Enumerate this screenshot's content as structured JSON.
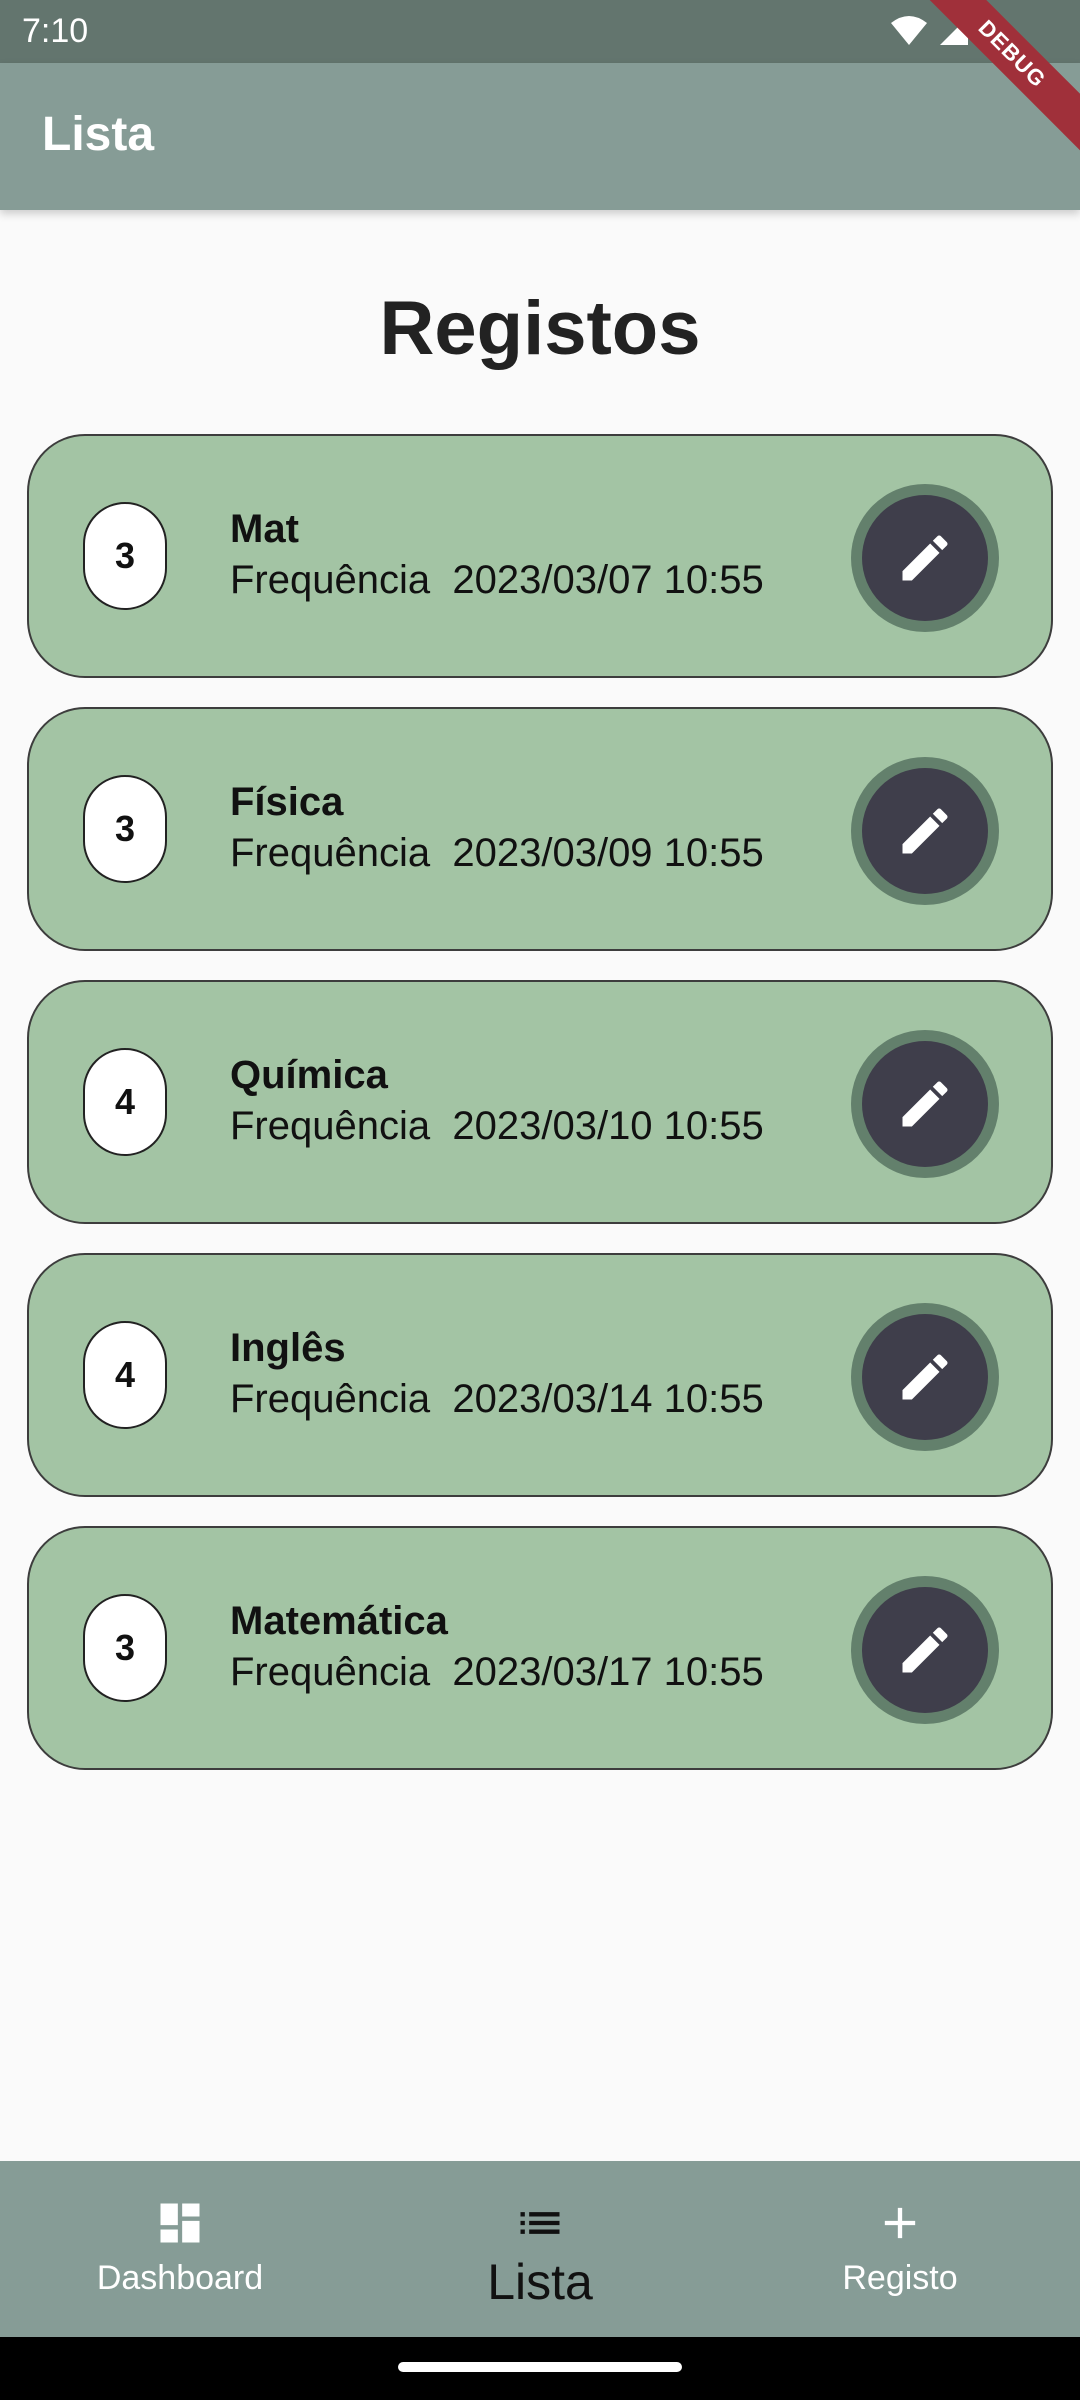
{
  "status_bar": {
    "time": "7:10",
    "icons": [
      "wifi-icon",
      "signal-icon",
      "battery-icon"
    ]
  },
  "debug_banner": "DEBUG",
  "app_bar": {
    "title": "Lista"
  },
  "page": {
    "heading": "Registos"
  },
  "frequency_label": "Frequência",
  "records": [
    {
      "count": "3",
      "subject": "Mat",
      "datetime": "2023/03/07 10:55"
    },
    {
      "count": "3",
      "subject": "Física",
      "datetime": "2023/03/09 10:55"
    },
    {
      "count": "4",
      "subject": "Química",
      "datetime": "2023/03/10 10:55"
    },
    {
      "count": "4",
      "subject": "Inglês",
      "datetime": "2023/03/14 10:55"
    },
    {
      "count": "3",
      "subject": "Matemática",
      "datetime": "2023/03/17 10:55"
    }
  ],
  "bottom_nav": {
    "items": [
      {
        "label": "Dashboard",
        "icon": "dashboard-icon",
        "active": false
      },
      {
        "label": "Lista",
        "icon": "list-icon",
        "active": true
      },
      {
        "label": "Registo",
        "icon": "plus-icon",
        "active": false
      }
    ]
  },
  "colors": {
    "status_bar": "#63756e",
    "app_bar": "#869c96",
    "card": "#a3c4a4",
    "edit_button": "#3f3e4b",
    "debug_banner": "#a0303a"
  }
}
